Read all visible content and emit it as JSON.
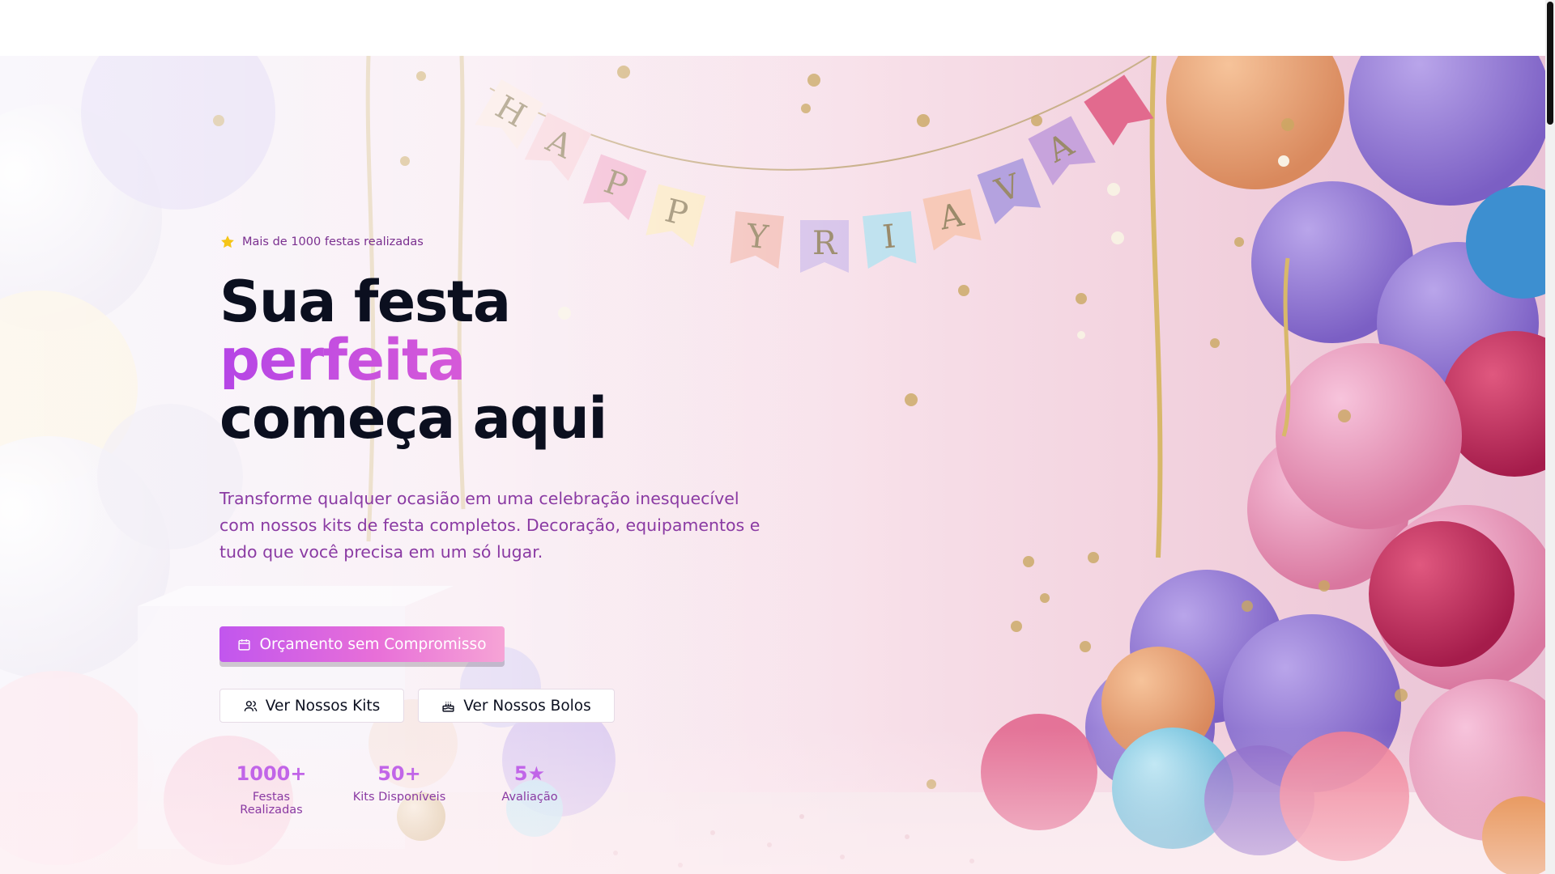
{
  "hero": {
    "badge": "Mais de 1000 festas realizadas",
    "headline": {
      "line1": "Sua festa",
      "line2": "perfeita",
      "line3": "começa aqui"
    },
    "description": "Transforme qualquer ocasião em uma celebração inesquecível com nossos kits de festa completos. Decoração, equipamentos e tudo que você precisa em um só lugar.",
    "primary_button": "Orçamento sem Compromisso",
    "secondary_buttons": {
      "kits": "Ver Nossos Kits",
      "bolos": "Ver Nossos Bolos"
    },
    "stats": [
      {
        "value": "1000+",
        "label": "Festas Realizadas"
      },
      {
        "value": "50+",
        "label": "Kits Disponíveis"
      },
      {
        "value": "5★",
        "label": "Avaliação"
      }
    ],
    "banner_letters": [
      "H",
      "A",
      "P",
      "P",
      "Y",
      "R",
      "I",
      "A",
      "V",
      "A"
    ]
  },
  "icons": {
    "badge": "star-icon",
    "primary_button": "calendar-icon",
    "kits_button": "users-icon",
    "bolos_button": "cake-icon"
  },
  "colors": {
    "headline": "#0b0f1f",
    "accent_gradient_start": "#b545e6",
    "accent_gradient_end": "#f39acb",
    "body_text": "#8a3aa3",
    "stat_value": "#c165e8"
  }
}
